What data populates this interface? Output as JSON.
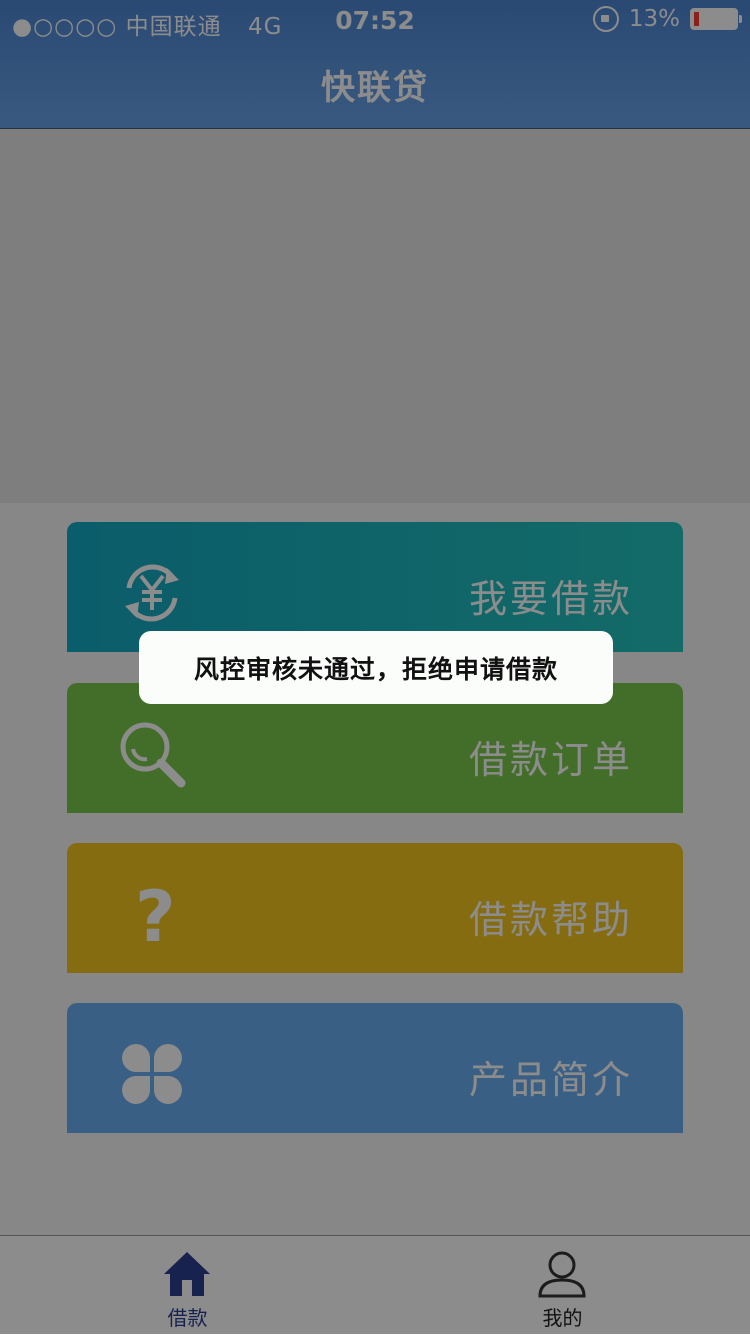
{
  "status_bar": {
    "carrier": "●○○○○ 中国联通",
    "network": "4G",
    "time": "07:52",
    "battery": "13%",
    "battery_level": 0.13
  },
  "header": {
    "title": "快联贷"
  },
  "menu": [
    {
      "label": "我要借款",
      "icon": "yuan-refresh-icon",
      "color": "#1bb5bf"
    },
    {
      "label": "借款订单",
      "icon": "search-icon",
      "color": "#7ac94c"
    },
    {
      "label": "借款帮助",
      "icon": "question-icon",
      "color": "#f4c51f"
    },
    {
      "label": "产品简介",
      "icon": "clover-icon",
      "color": "#6aaef1"
    }
  ],
  "toast": {
    "message": "风控审核未通过，拒绝申请借款"
  },
  "tabbar": {
    "items": [
      {
        "label": "借款",
        "icon": "home-icon",
        "active": true,
        "color": "#2c3e8f"
      },
      {
        "label": "我的",
        "icon": "user-icon",
        "active": false,
        "color": "#333333"
      }
    ]
  }
}
